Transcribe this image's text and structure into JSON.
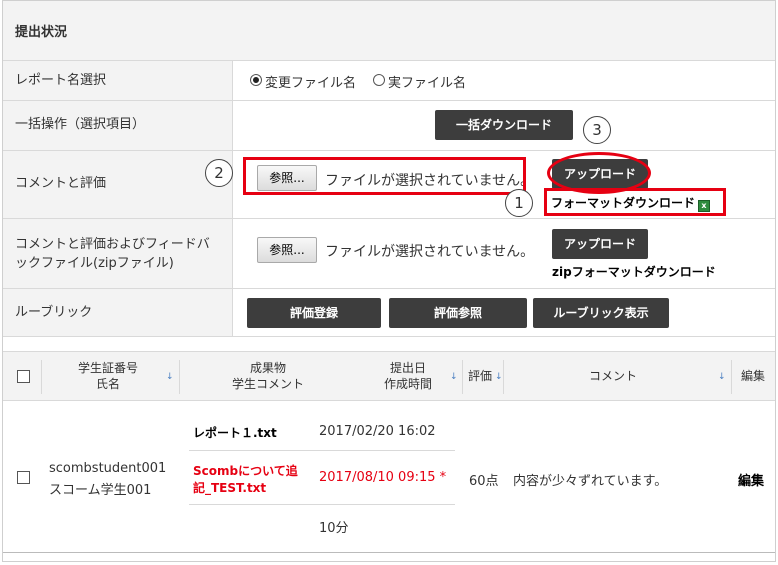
{
  "section_title": "提出状況",
  "rows": {
    "report_name": {
      "label": "レポート名選択",
      "options": [
        "変更ファイル名",
        "実ファイル名"
      ],
      "selected": 0
    },
    "bulk": {
      "label": "一括操作（選択項目）",
      "button": "一括ダウンロード"
    },
    "comment": {
      "label": "コメントと評価",
      "browse": "参照...",
      "no_file": "ファイルが選択されていません。",
      "upload": "アップロード",
      "format_download": "フォーマットダウンロード"
    },
    "comment_zip": {
      "label_line1": "コメントと評価およびフィードバ",
      "label_line2": "ックファイル(zipファイル)",
      "browse": "参照...",
      "no_file": "ファイルが選択されていません。",
      "upload": "アップロード",
      "zip_download": "zipフォーマットダウンロード"
    },
    "rubric": {
      "label": "ルーブリック",
      "buttons": [
        "評価登録",
        "評価参照",
        "ルーブリック表示"
      ]
    }
  },
  "callouts": [
    "2",
    "1",
    "3"
  ],
  "table": {
    "headers": {
      "student_line1": "学生証番号",
      "student_line2": "氏名",
      "work_line1": "成果物",
      "work_line2": "学生コメント",
      "date_line1": "提出日",
      "date_line2": "作成時間",
      "grade": "評価",
      "comment": "コメント",
      "edit": "編集"
    },
    "row": {
      "student_id": "scombstudent001",
      "student_name": "スコーム学生001",
      "file1": "レポート１.txt",
      "date1": "2017/02/20 16:02",
      "file2_line1": "Scombについて追",
      "file2_line2": "記_TEST.txt",
      "date2": "2017/08/10 09:15 *",
      "grade": "60点",
      "comment": "内容が少々ずれています。",
      "edit": "編集",
      "duration": "10分"
    }
  },
  "colors": {
    "annotation_red": "#e60012",
    "dark_button": "#3d3d3d",
    "label_bg": "#f3f3f3",
    "sort_blue": "#4a7fc1"
  }
}
